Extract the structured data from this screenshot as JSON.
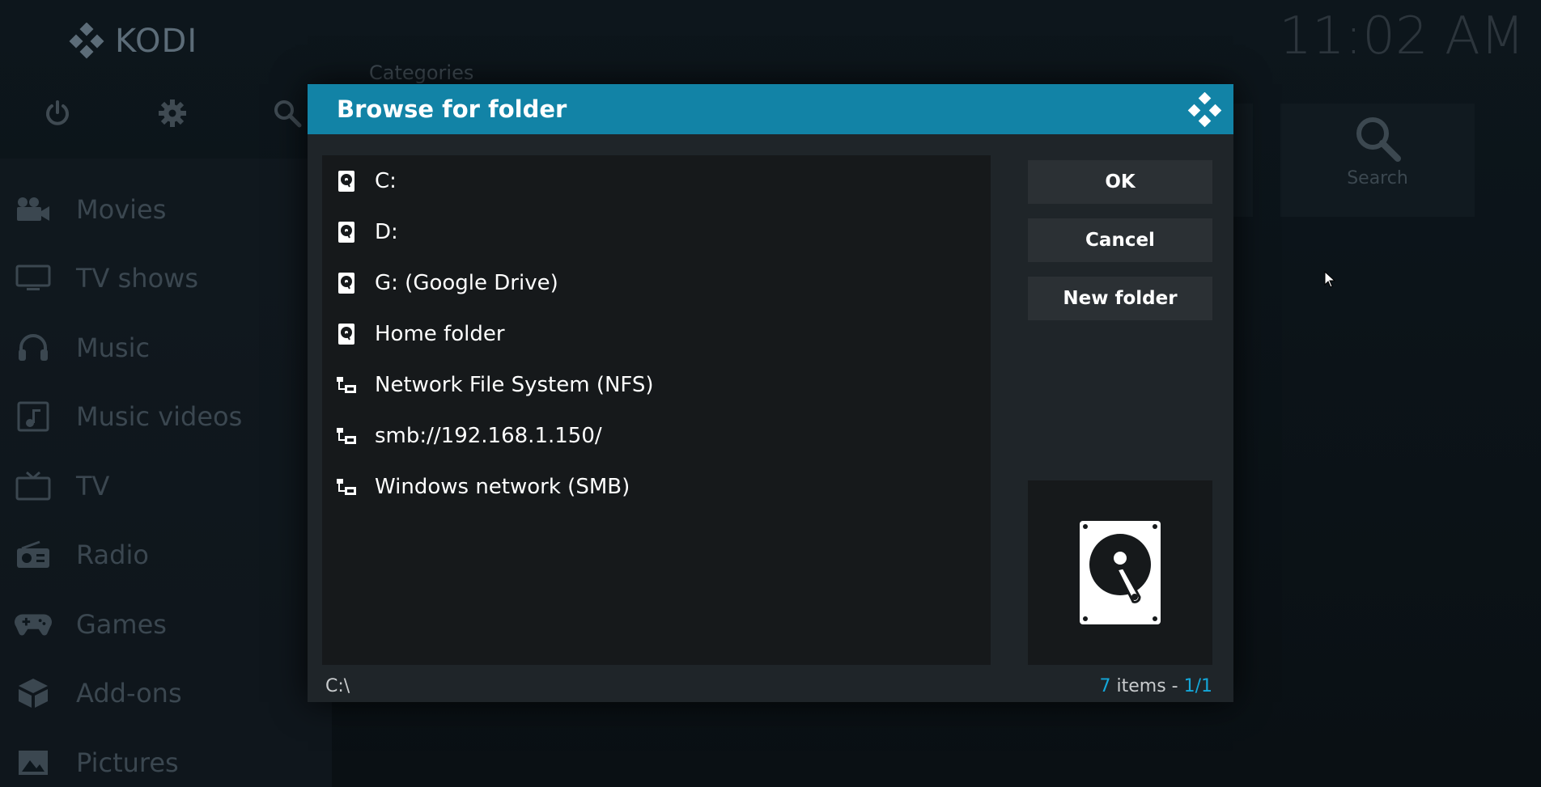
{
  "app": {
    "logo_text": "KODI",
    "clock": "11:02 AM"
  },
  "home": {
    "categories_label": "Categories",
    "top_icons": [
      "power-icon",
      "gear-icon",
      "search-icon"
    ],
    "menu": [
      {
        "label": "Movies",
        "icon": "movie-camera-icon"
      },
      {
        "label": "TV shows",
        "icon": "monitor-icon"
      },
      {
        "label": "Music",
        "icon": "headphones-icon"
      },
      {
        "label": "Music videos",
        "icon": "music-video-icon"
      },
      {
        "label": "TV",
        "icon": "tv-icon"
      },
      {
        "label": "Radio",
        "icon": "radio-icon"
      },
      {
        "label": "Games",
        "icon": "gamepad-icon"
      },
      {
        "label": "Add-ons",
        "icon": "addons-box-icon"
      },
      {
        "label": "Pictures",
        "icon": "pictures-icon"
      }
    ],
    "search_tile_label": "Search"
  },
  "dialog": {
    "title": "Browse for folder",
    "items": [
      {
        "label": "C:",
        "icon": "hard-drive-icon"
      },
      {
        "label": "D:",
        "icon": "hard-drive-icon"
      },
      {
        "label": "G: (Google Drive)",
        "icon": "hard-drive-icon"
      },
      {
        "label": "Home folder",
        "icon": "hard-drive-icon"
      },
      {
        "label": "Network File System (NFS)",
        "icon": "network-icon"
      },
      {
        "label": "smb://192.168.1.150/",
        "icon": "network-icon"
      },
      {
        "label": "Windows network (SMB)",
        "icon": "network-icon"
      }
    ],
    "buttons": {
      "ok": "OK",
      "cancel": "Cancel",
      "new_folder": "New folder"
    },
    "preview_icon": "hard-drive-icon",
    "current_path": "C:\\",
    "count": {
      "items": "7",
      "items_word": " items - ",
      "page": "1/1"
    }
  },
  "colors": {
    "accent": "#14a7d9",
    "header": "#1283a6"
  }
}
